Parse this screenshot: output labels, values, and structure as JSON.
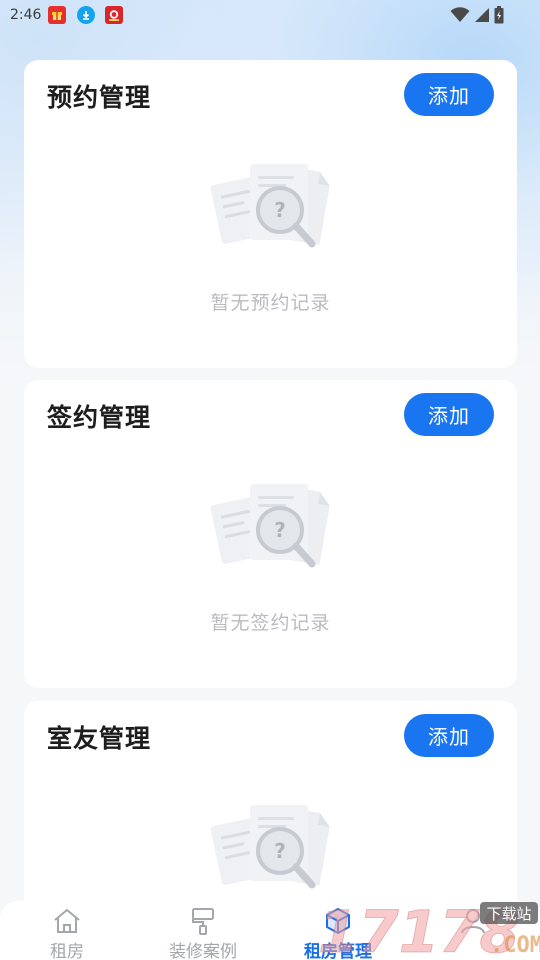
{
  "status_bar": {
    "time": "2:46",
    "notification_icons": [
      "gift-notification-icon",
      "download-notification-icon",
      "app-notification-icon"
    ],
    "system_icons": [
      "wifi-icon",
      "signal-icon",
      "battery-icon"
    ]
  },
  "sections": [
    {
      "title": "预约管理",
      "add_label": "添加",
      "empty_text": "暂无预约记录"
    },
    {
      "title": "签约管理",
      "add_label": "添加",
      "empty_text": "暂无签约记录"
    },
    {
      "title": "室友管理",
      "add_label": "添加"
    }
  ],
  "bottom_nav": {
    "items": [
      {
        "label": "租房",
        "icon": "home-icon",
        "active": false
      },
      {
        "label": "装修案例",
        "icon": "paint-roller-icon",
        "active": false
      },
      {
        "label": "租房管理",
        "icon": "cube-icon",
        "active": true
      },
      {
        "label": "",
        "icon": "profile-icon",
        "active": false
      }
    ]
  },
  "watermark": {
    "text": "17178",
    "badge": "下载站",
    "domain": ".COM"
  },
  "colors": {
    "accent": "#1a75f0",
    "nav_active": "#1a6fe8",
    "nav_inactive": "#a3a6ac",
    "empty_text": "#b9bbbf",
    "page_bg": "#f6f7f9"
  }
}
